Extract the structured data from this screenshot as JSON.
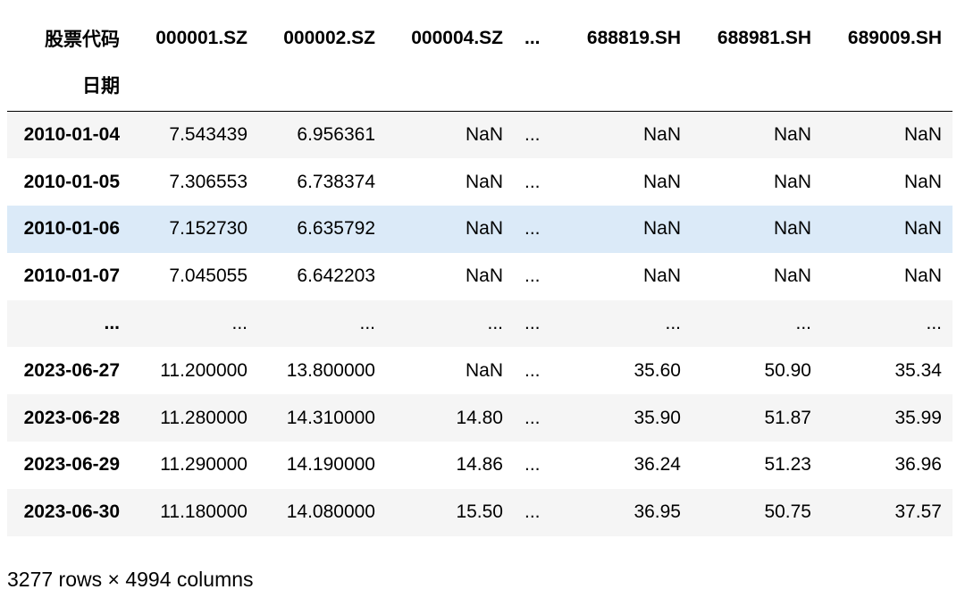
{
  "table": {
    "columns_name": "股票代码",
    "index_name": "日期",
    "columns": [
      "000001.SZ",
      "000002.SZ",
      "000004.SZ",
      "...",
      "688819.SH",
      "688981.SH",
      "689009.SH"
    ],
    "rows": [
      {
        "index": "2010-01-04",
        "values": [
          "7.543439",
          "6.956361",
          "NaN",
          "...",
          "NaN",
          "NaN",
          "NaN"
        ]
      },
      {
        "index": "2010-01-05",
        "values": [
          "7.306553",
          "6.738374",
          "NaN",
          "...",
          "NaN",
          "NaN",
          "NaN"
        ]
      },
      {
        "index": "2010-01-06",
        "values": [
          "7.152730",
          "6.635792",
          "NaN",
          "...",
          "NaN",
          "NaN",
          "NaN"
        ]
      },
      {
        "index": "2010-01-07",
        "values": [
          "7.045055",
          "6.642203",
          "NaN",
          "...",
          "NaN",
          "NaN",
          "NaN"
        ]
      },
      {
        "index": "...",
        "values": [
          "...",
          "...",
          "...",
          "...",
          "...",
          "...",
          "..."
        ]
      },
      {
        "index": "2023-06-27",
        "values": [
          "11.200000",
          "13.800000",
          "NaN",
          "...",
          "35.60",
          "50.90",
          "35.34"
        ]
      },
      {
        "index": "2023-06-28",
        "values": [
          "11.280000",
          "14.310000",
          "14.80",
          "...",
          "35.90",
          "51.87",
          "35.99"
        ]
      },
      {
        "index": "2023-06-29",
        "values": [
          "11.290000",
          "14.190000",
          "14.86",
          "...",
          "36.24",
          "51.23",
          "36.96"
        ]
      },
      {
        "index": "2023-06-30",
        "values": [
          "11.180000",
          "14.080000",
          "15.50",
          "...",
          "36.95",
          "50.75",
          "37.57"
        ]
      }
    ],
    "highlighted_row": 2
  },
  "footer": "3277 rows × 4994 columns",
  "colors": {
    "stripe": "#f5f5f5",
    "hover": "#dbeaf8",
    "text": "#000000"
  }
}
